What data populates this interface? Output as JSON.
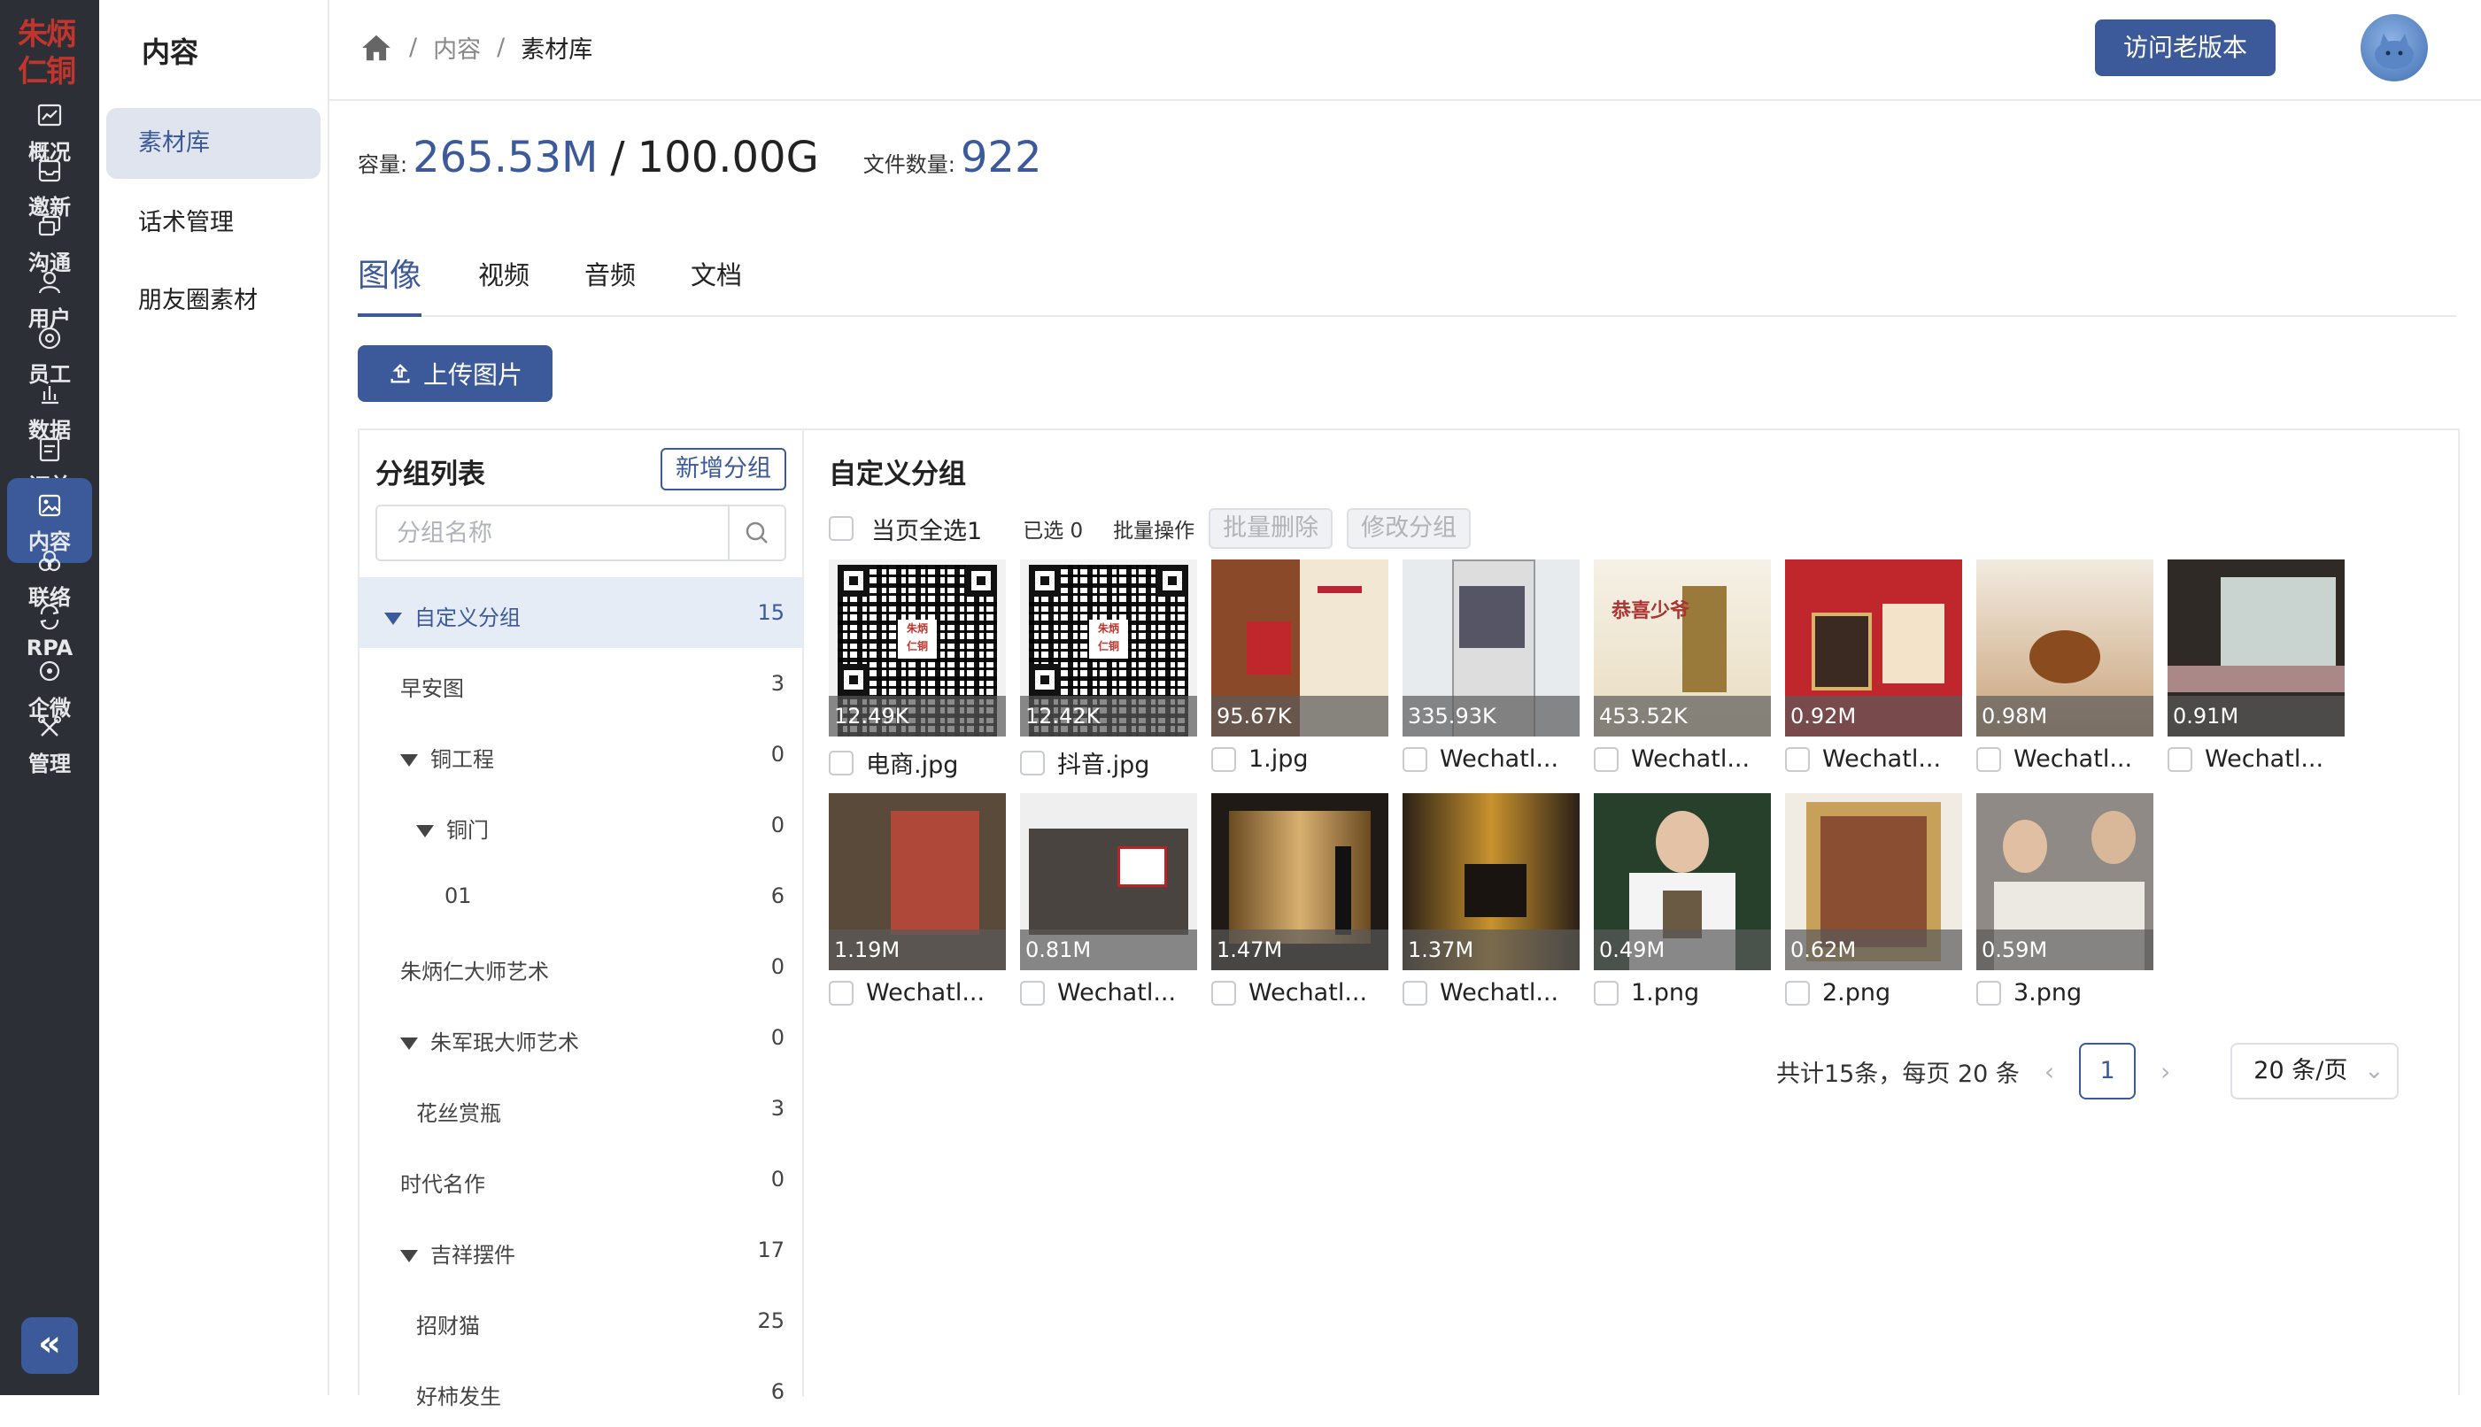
{
  "logo_text": "朱炳仁铜",
  "rail": [
    {
      "label": "概况",
      "icon": "chart-icon",
      "active": false
    },
    {
      "label": "邀新",
      "icon": "inbox-icon",
      "active": false
    },
    {
      "label": "沟通",
      "icon": "chat-icon",
      "active": false
    },
    {
      "label": "用户",
      "icon": "user-icon",
      "active": false
    },
    {
      "label": "员工",
      "icon": "staff-icon",
      "active": false
    },
    {
      "label": "数据",
      "icon": "bar-chart-icon",
      "active": false
    },
    {
      "label": "订单",
      "icon": "order-icon",
      "active": false
    },
    {
      "label": "内容",
      "icon": "image-icon",
      "active": true
    },
    {
      "label": "联络",
      "icon": "connect-icon",
      "active": false
    },
    {
      "label": "RPA",
      "icon": "rpa-icon",
      "active": false
    },
    {
      "label": "企微",
      "icon": "wecom-icon",
      "active": false
    },
    {
      "label": "管理",
      "icon": "tools-icon",
      "active": false
    }
  ],
  "collapse_glyph": "«",
  "submenu": {
    "title": "内容",
    "items": [
      {
        "label": "素材库",
        "active": true
      },
      {
        "label": "话术管理",
        "active": false
      },
      {
        "label": "朋友圈素材",
        "active": false
      }
    ]
  },
  "breadcrumb": {
    "sep1": "/",
    "item1": "内容",
    "sep2": "/",
    "current": "素材库"
  },
  "header": {
    "old_version_button": "访问老版本"
  },
  "storage": {
    "capacity_label": "容量:",
    "used": "265.53M",
    "slash": "/",
    "total": "100.00G",
    "count_label": "文件数量:",
    "count": "922"
  },
  "tabs": [
    {
      "label": "图像",
      "active": true
    },
    {
      "label": "视频",
      "active": false
    },
    {
      "label": "音频",
      "active": false
    },
    {
      "label": "文档",
      "active": false
    }
  ],
  "upload_button": "上传图片",
  "groups": {
    "title": "分组列表",
    "add_button": "新增分组",
    "search_placeholder": "分组名称",
    "tree": [
      {
        "name": "自定义分组",
        "count": "15",
        "level": 0,
        "expanded": true,
        "selected": true
      },
      {
        "name": "早安图",
        "count": "3",
        "level": 1,
        "expanded": null,
        "selected": false
      },
      {
        "name": "铜工程",
        "count": "0",
        "level": 1,
        "expanded": true,
        "selected": false
      },
      {
        "name": "铜门",
        "count": "0",
        "level": 2,
        "expanded": true,
        "selected": false
      },
      {
        "name": "01",
        "count": "6",
        "level": 3,
        "expanded": null,
        "selected": false
      },
      {
        "name": "朱炳仁大师艺术",
        "count": "0",
        "level": 1,
        "expanded": null,
        "selected": false
      },
      {
        "name": "朱军珉大师艺术",
        "count": "0",
        "level": 1,
        "expanded": true,
        "selected": false
      },
      {
        "name": "花丝赏瓶",
        "count": "3",
        "level": 2,
        "expanded": null,
        "selected": false
      },
      {
        "name": "时代名作",
        "count": "0",
        "level": 1,
        "expanded": null,
        "selected": false
      },
      {
        "name": "吉祥摆件",
        "count": "17",
        "level": 1,
        "expanded": true,
        "selected": false
      },
      {
        "name": "招财猫",
        "count": "25",
        "level": 2,
        "expanded": null,
        "selected": false
      },
      {
        "name": "好柿发生",
        "count": "6",
        "level": 2,
        "expanded": null,
        "selected": false
      }
    ]
  },
  "content": {
    "title": "自定义分组",
    "select_all": "当页全选1",
    "selected": "已选 0",
    "batch_label": "批量操作",
    "batch_delete": "批量删除",
    "change_group": "修改分组"
  },
  "files": [
    {
      "name": "电商.jpg",
      "size": "12.49K",
      "kind": "qr"
    },
    {
      "name": "抖音.jpg",
      "size": "12.42K",
      "kind": "qr"
    },
    {
      "name": "1.jpg",
      "size": "95.67K",
      "kind": "red-book"
    },
    {
      "name": "Wechatl...",
      "size": "335.93K",
      "kind": "phone"
    },
    {
      "name": "Wechatl...",
      "size": "453.52K",
      "kind": "pagoda"
    },
    {
      "name": "Wechatl...",
      "size": "0.92M",
      "kind": "red-poster"
    },
    {
      "name": "Wechatl...",
      "size": "0.98M",
      "kind": "teapot"
    },
    {
      "name": "Wechatl...",
      "size": "0.91M",
      "kind": "room-window"
    },
    {
      "name": "Wechatl...",
      "size": "1.19M",
      "kind": "shelf-room"
    },
    {
      "name": "Wechatl...",
      "size": "0.81M",
      "kind": "gallery"
    },
    {
      "name": "Wechatl...",
      "size": "1.47M",
      "kind": "bottles"
    },
    {
      "name": "Wechatl...",
      "size": "1.37M",
      "kind": "gold-room"
    },
    {
      "name": "1.png",
      "size": "0.49M",
      "kind": "person"
    },
    {
      "name": "2.png",
      "size": "0.62M",
      "kind": "framed-art"
    },
    {
      "name": "3.png",
      "size": "0.59M",
      "kind": "craftsmen"
    }
  ],
  "pager": {
    "total_text": "共计15条，每页 20 条",
    "prev": "‹",
    "page": "1",
    "next": "›",
    "page_size": "20 条/页",
    "dropdown_glyph": "⌄"
  },
  "colors": {
    "accent": "#3c5a99",
    "rail": "#2c2f35",
    "logo": "#c2352e"
  }
}
